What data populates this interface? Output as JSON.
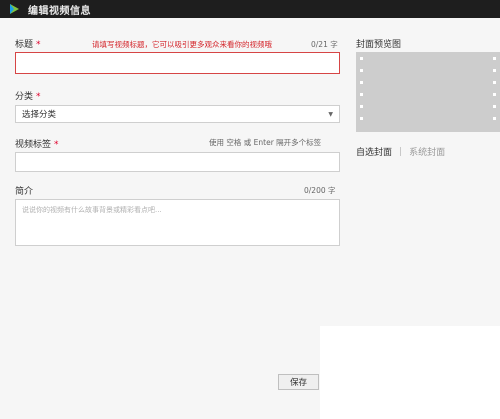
{
  "window": {
    "title": "编辑视频信息",
    "logo_icon": "play-logo-icon"
  },
  "form": {
    "title_field": {
      "label": "标题",
      "required_mark": "*",
      "error_hint": "请填写视频标题，它可以吸引更多观众来看你的视频哦",
      "counter": "0/21 字",
      "value": ""
    },
    "category_field": {
      "label": "分类",
      "required_mark": "*",
      "selected": "选择分类",
      "dropdown_icon": "caret-down-icon"
    },
    "tags_field": {
      "label": "视频标签",
      "required_mark": "*",
      "hint": "使用 空格 或 Enter 隔开多个标签",
      "value": ""
    },
    "description_field": {
      "label": "简介",
      "counter": "0/200 字",
      "placeholder": "说说你的视频有什么故事背景或精彩看点吧..."
    }
  },
  "cover": {
    "heading": "封面预览图",
    "custom_cover": "自选封面",
    "separator": "|",
    "system_cover": "系统封面"
  },
  "actions": {
    "save_label": "保存"
  },
  "colors": {
    "titlebar_bg": "#1e1e1e",
    "panel_bg": "#f6f6f6",
    "required": "#e0002c",
    "error_text": "#d4252b",
    "error_border": "#d64545",
    "preview_bg": "#cdcdcd"
  }
}
